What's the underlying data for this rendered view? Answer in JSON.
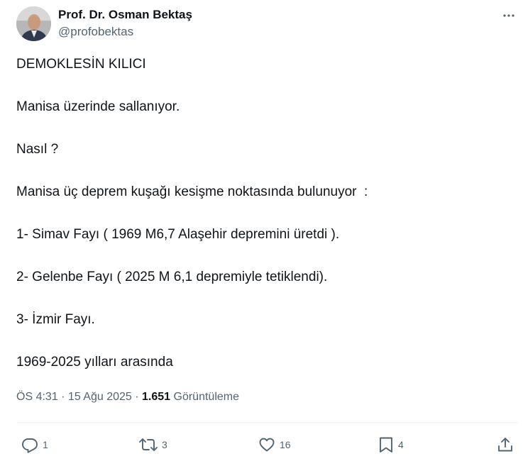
{
  "author": {
    "display_name": "Prof. Dr. Osman Bektaş",
    "handle": "@profobektas"
  },
  "post": {
    "paragraphs": [
      "DEMOKLESİN KILICI",
      "Manisa üzerinde sallanıyor.",
      "Nasıl ?",
      "Manisa üç deprem kuşağı kesişme noktasında bulunuyor  :",
      "1- Simav Fayı ( 1969 M6,7 Alaşehir depremini üretdi ).",
      "2- Gelenbe Fayı ( 2025 M 6,1 depremiyle tetiklendi).",
      "3- İzmir Fayı.",
      "1969-2025 yılları arasında"
    ]
  },
  "meta": {
    "time": "ÖS 4:31",
    "sep1": " · ",
    "date": "15 Ağu 2025",
    "sep2": " · ",
    "views_count": "1.651",
    "views_label": " Görüntüleme"
  },
  "actions": {
    "reply": {
      "icon": "reply-icon",
      "count": "1"
    },
    "repost": {
      "icon": "repost-icon",
      "count": "3"
    },
    "like": {
      "icon": "heart-icon",
      "count": "16"
    },
    "bookmark": {
      "icon": "bookmark-icon",
      "count": "4"
    },
    "share": {
      "icon": "share-icon"
    }
  },
  "colors": {
    "text": "#0f1419",
    "secondary": "#536471",
    "divider": "#eff3f4"
  }
}
